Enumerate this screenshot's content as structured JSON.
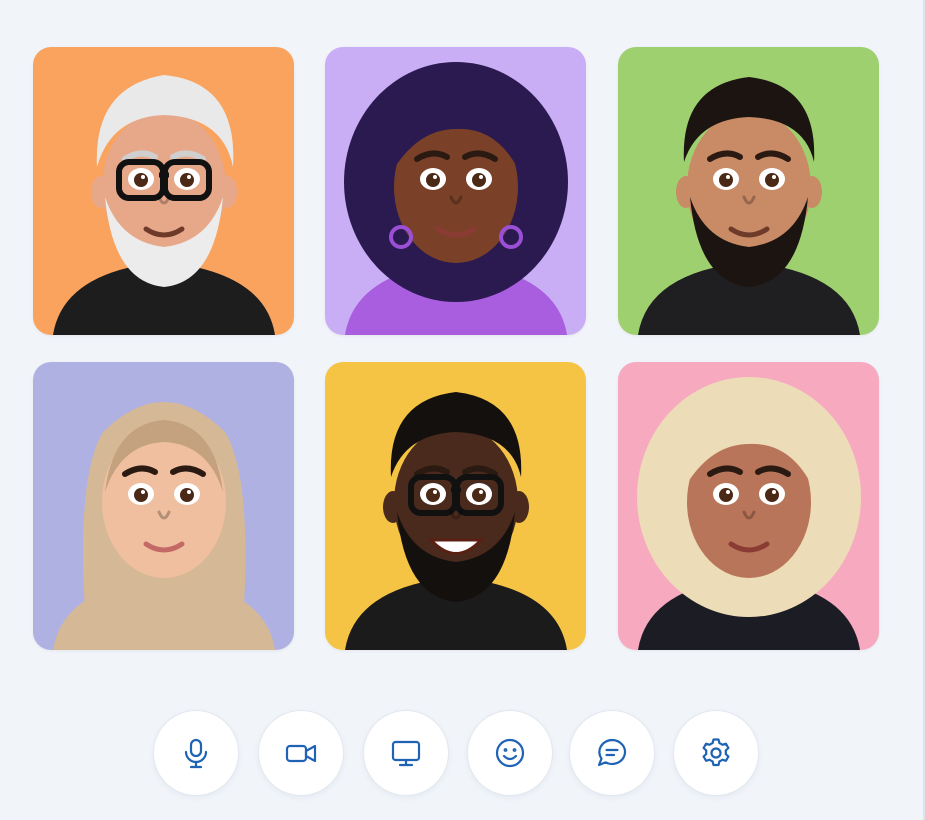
{
  "participants": [
    {
      "bg": "#f9a35e",
      "skin": "#e7a88a",
      "hair": "#e9e9e9",
      "top": "#1d1d1d",
      "beard": "#ececec",
      "glasses": true
    },
    {
      "bg": "#c9aef5",
      "skin": "#7a4128",
      "hair": "#2a1a4f",
      "top": "#a95ee0",
      "beard": null,
      "glasses": false
    },
    {
      "bg": "#9fd06f",
      "skin": "#c98a66",
      "hair": "#1b1410",
      "top": "#1f1f22",
      "beard": "#1b1410",
      "glasses": false
    },
    {
      "bg": "#aeb1e2",
      "skin": "#f0bfa0",
      "hair": "#d5b896",
      "top": "#d5b896",
      "beard": null,
      "glasses": false
    },
    {
      "bg": "#f6c445",
      "skin": "#4a2a1c",
      "hair": "#14100e",
      "top": "#1b1b1b",
      "beard": "#14100e",
      "glasses": true
    },
    {
      "bg": "#f7a9c0",
      "skin": "#b9755a",
      "hair": "#ecdcb7",
      "top": "#1c1c24",
      "beard": null,
      "glasses": false
    }
  ],
  "controls": [
    {
      "icon": "microphone-icon"
    },
    {
      "icon": "video-camera-icon"
    },
    {
      "icon": "screen-share-icon"
    },
    {
      "icon": "emoji-reaction-icon"
    },
    {
      "icon": "chat-icon"
    },
    {
      "icon": "settings-gear-icon"
    }
  ],
  "colors": {
    "background": "#f1f5fa",
    "accent": "#1f63b5",
    "button_bg": "#ffffff"
  }
}
